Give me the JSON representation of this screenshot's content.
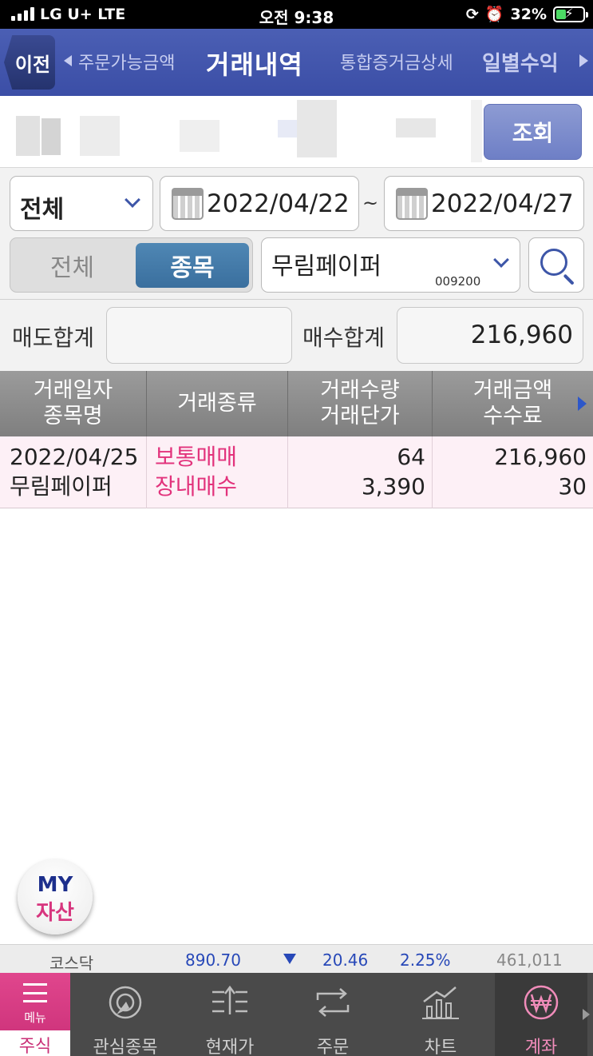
{
  "status": {
    "carrier": "LG U+  LTE",
    "time": "오전 9:38",
    "battery": "32%"
  },
  "header": {
    "back_label": "이전",
    "prev_tab": "주문가능금액",
    "title": "거래내역",
    "next_tab": "통합증거금상세",
    "next_tab2": "일별수익"
  },
  "account": {
    "query_label": "조회"
  },
  "filter": {
    "type_selected": "전체",
    "date_from": "2022/04/22",
    "date_separator": "~",
    "date_to": "2022/04/27",
    "segment_all": "전체",
    "segment_stock": "종목",
    "stock_name": "무림페이퍼",
    "stock_code": "009200"
  },
  "totals": {
    "sell_label": "매도합계",
    "sell_value": "",
    "buy_label": "매수합계",
    "buy_value": "216,960"
  },
  "table": {
    "headers": [
      {
        "l1": "거래일자",
        "l2": "종목명"
      },
      {
        "l1": "거래종류",
        "l2": ""
      },
      {
        "l1": "거래수량",
        "l2": "거래단가"
      },
      {
        "l1": "거래금액",
        "l2": "수수료"
      }
    ],
    "rows": [
      {
        "date": "2022/04/25",
        "stock": "무림페이퍼",
        "type1": "보통매매",
        "type2": "장내매수",
        "qty": "64",
        "price": "3,390",
        "amount": "216,960",
        "fee": "30"
      }
    ]
  },
  "my_asset": {
    "line1": "MY",
    "line2": "자산"
  },
  "ticker": {
    "index_name": "코스닥",
    "value": "890.70",
    "change": "20.46",
    "percent": "2.25%",
    "volume": "461,011"
  },
  "tabbar": {
    "menu_sub": "메뉴",
    "menu_label": "주식",
    "items": [
      "관심종목",
      "현재가",
      "주문",
      "차트",
      "계좌"
    ]
  },
  "colors": {
    "header_blue": "#4b5fb4",
    "accent_pink": "#e2337c",
    "row_bg": "#fdf0f6",
    "ticker_blue": "#2748b8"
  }
}
